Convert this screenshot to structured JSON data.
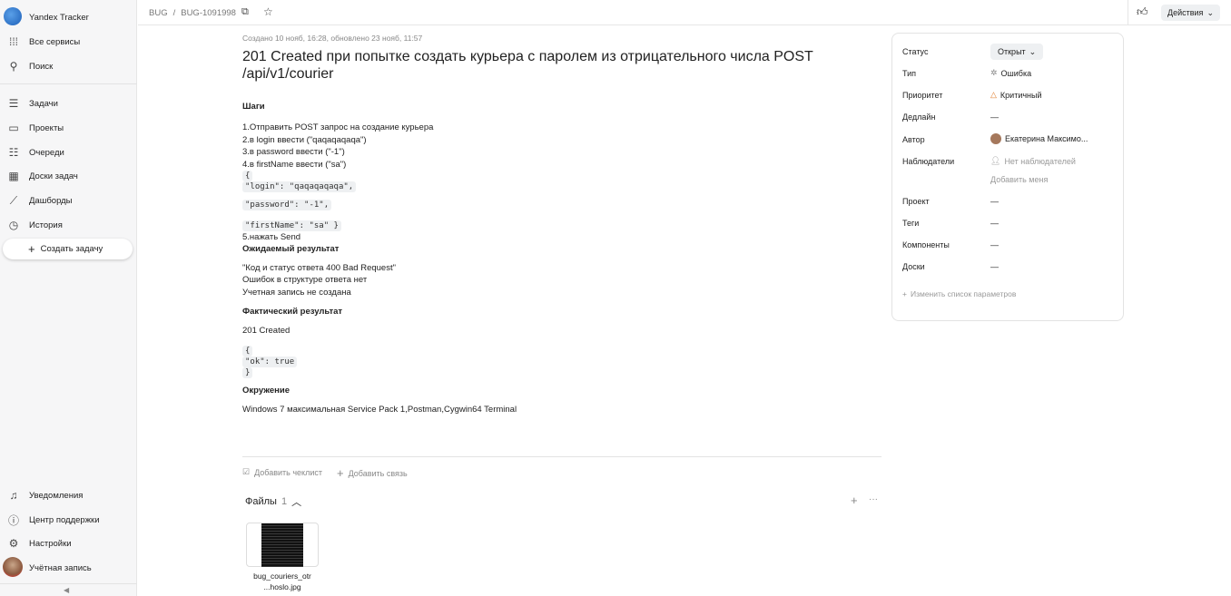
{
  "sidebar": {
    "app_title": "Yandex Tracker",
    "all_services": "Все сервисы",
    "search": "Поиск",
    "items": [
      {
        "label": "Задачи",
        "icon": "tasks-icon"
      },
      {
        "label": "Проекты",
        "icon": "projects-icon"
      },
      {
        "label": "Очереди",
        "icon": "queues-icon"
      },
      {
        "label": "Доски задач",
        "icon": "boards-icon"
      },
      {
        "label": "Дашборды",
        "icon": "dashboards-icon"
      },
      {
        "label": "История",
        "icon": "history-icon"
      }
    ],
    "create_task": "Создать задачу",
    "bottom": [
      {
        "label": "Уведомления"
      },
      {
        "label": "Центр поддержки"
      },
      {
        "label": "Настройки"
      },
      {
        "label": "Учётная запись"
      }
    ]
  },
  "topbar": {
    "queue": "BUG",
    "sep": "/",
    "issue_key": "BUG-1091998",
    "actions": "Действия"
  },
  "issue": {
    "meta": "Создано 10 нояб, 16:28, обновлено 23 нояб, 11:57",
    "title": "201 Created при попытке создать курьера с паролем из отрицательного числа POST /api/v1/courier",
    "steps_h": "Шаги",
    "steps": [
      "1.Отправить POST запрос на создание курьера",
      "2.в login ввести (\"qaqaqaqaqa\")",
      "3.в password ввести (\"-1\")",
      "4.в firstName ввести (\"sa\")"
    ],
    "code1": [
      "{",
      "\"login\": \"qaqaqaqaqa\","
    ],
    "code2": "\"password\": \"-1\",",
    "code3": "\"firstName\": \"sa\" }",
    "step5": "5.нажать Send",
    "expected_h": "Ожидаемый результат",
    "expected": [
      "\"Код и статус ответа 400 Bad Request\"",
      "Ошибок в структуре ответа нет",
      "Учетная запись не создана"
    ],
    "actual_h": "Фактический результат",
    "actual": "201 Created",
    "code4": [
      "{",
      "\"ok\": true",
      "}"
    ],
    "env_h": "Окружение",
    "env": "Windows 7 максимальная Service Pack 1,Postman,Cygwin64 Terminal",
    "add_checklist": "Добавить чеклист",
    "add_link": "Добавить связь",
    "files_label": "Файлы",
    "files_count": "1",
    "file_name_1": "bug_couriers_otr",
    "file_name_2": "...hoslo.jpg"
  },
  "panel": {
    "status_l": "Статус",
    "status_v": "Открыт",
    "type_l": "Тип",
    "type_v": "Ошибка",
    "priority_l": "Приоритет",
    "priority_v": "Критичный",
    "deadline_l": "Дедлайн",
    "dash": "—",
    "author_l": "Автор",
    "author_v": "Екатерина Максимо...",
    "watchers_l": "Наблюдатели",
    "watchers_v": "Нет наблюдателей",
    "add_me": "Добавить меня",
    "project_l": "Проект",
    "tags_l": "Теги",
    "components_l": "Компоненты",
    "boards_l": "Доски",
    "edit_params": "Изменить список параметров"
  },
  "colors": {
    "priority": "#e07b2a",
    "sidebar_bg": "#f6f6f7"
  }
}
